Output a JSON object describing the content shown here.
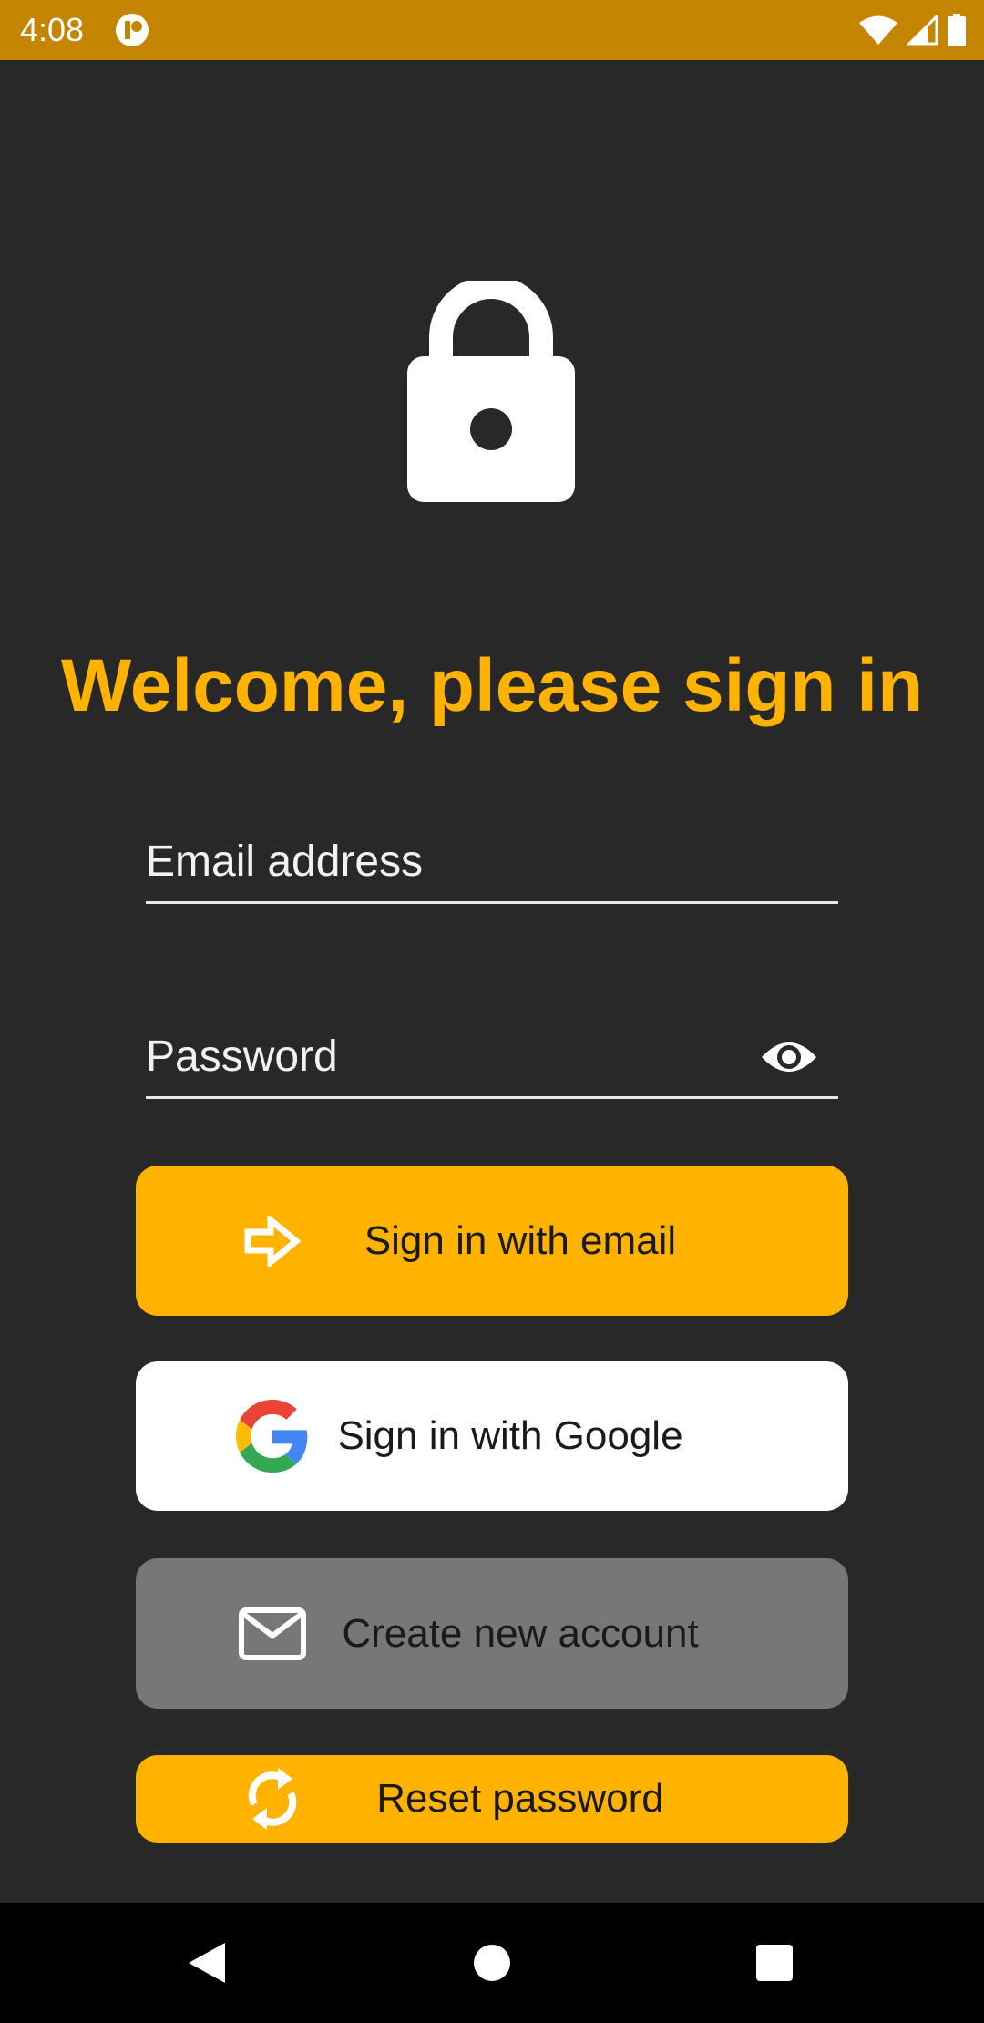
{
  "status_bar": {
    "time": "4:08",
    "background": "#C48500"
  },
  "header": {
    "lock_icon": "lock-icon",
    "title": "Welcome, please sign in",
    "title_color": "#FFB300"
  },
  "form": {
    "email": {
      "placeholder": "Email address",
      "value": ""
    },
    "password": {
      "placeholder": "Password",
      "value": "",
      "toggle_icon": "eye-icon"
    }
  },
  "buttons": {
    "email": {
      "label": "Sign in with email",
      "icon": "arrow-right-icon",
      "color": "#FFB300"
    },
    "google": {
      "label": "Sign in with Google",
      "icon": "google-logo-icon",
      "color": "#FFFFFF"
    },
    "create": {
      "label": "Create new account",
      "icon": "envelope-icon",
      "color": "#777777"
    },
    "reset": {
      "label": "Reset password",
      "icon": "refresh-icon",
      "color": "#FFB300"
    }
  },
  "nav_bar": {
    "back": "back-icon",
    "home": "home-icon",
    "recents": "recents-icon"
  }
}
